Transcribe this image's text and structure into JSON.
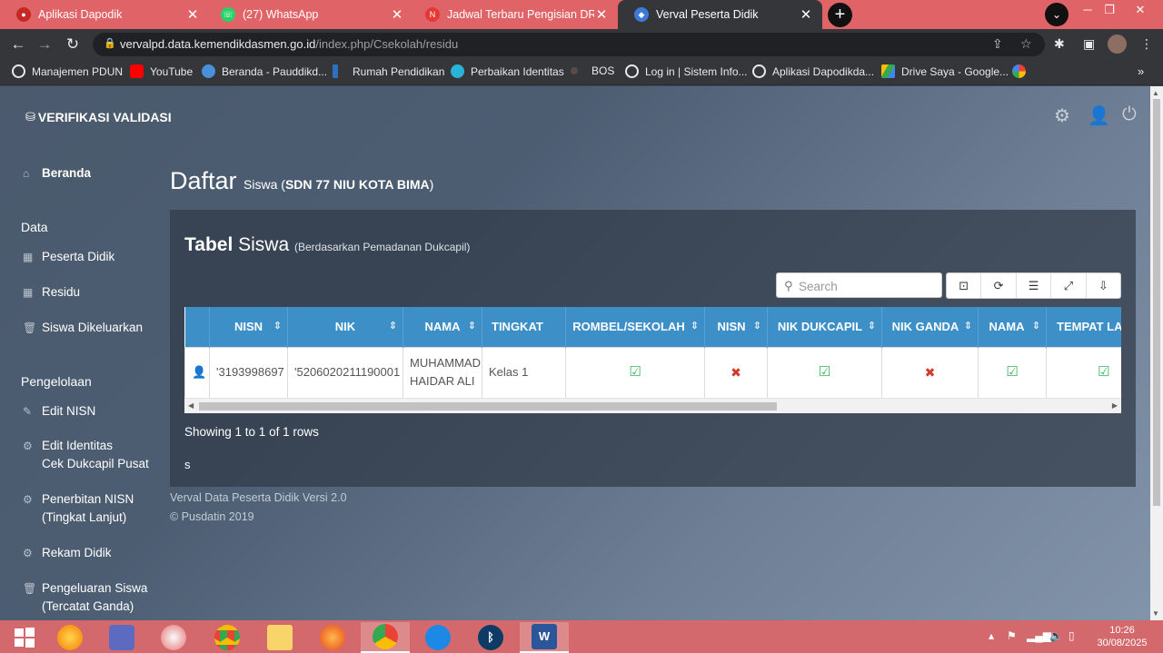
{
  "browser": {
    "tabs": [
      {
        "title": "Aplikasi Dapodik",
        "color": "#c62828"
      },
      {
        "title": "(27) WhatsApp",
        "color": "#25d366"
      },
      {
        "title": "Jadwal Terbaru Pengisian DRH PPPK",
        "color": "#e53935"
      },
      {
        "title": "Verval Peserta Didik",
        "color": "#3d7ad6"
      }
    ],
    "url_domain": "vervalpd.data.kemendikdasmen.go.id",
    "url_path": "/index.php/Csekolah/residu",
    "bookmarks": [
      {
        "label": "Manajemen PDUN",
        "icon": "globe-icon"
      },
      {
        "label": "YouTube",
        "icon": "youtube-icon"
      },
      {
        "label": "Beranda - Pauddikd...",
        "icon": "paud-icon"
      },
      {
        "label": "Rumah Pendidikan",
        "icon": "rumah-icon"
      },
      {
        "label": "Perbaikan Identitas",
        "icon": "perbaikan-icon"
      },
      {
        "label": "BOS",
        "icon": "bos-icon"
      },
      {
        "label": "Log in | Sistem Info...",
        "icon": "globe-icon"
      },
      {
        "label": "Aplikasi Dapodikda...",
        "icon": "globe-icon"
      },
      {
        "label": "Drive Saya - Google...",
        "icon": "drive-icon"
      }
    ]
  },
  "app": {
    "brand": "VERIFIKASI VALIDASI",
    "sidebar": {
      "beranda": "Beranda",
      "data_heading": "Data",
      "data_items": [
        "Peserta Didik",
        "Residu",
        "Siswa Dikeluarkan"
      ],
      "pengelolaan_heading": "Pengelolaan",
      "edit_nisn": "Edit NISN",
      "edit_identitas_1": "Edit Identitas",
      "edit_identitas_2": "Cek Dukcapil Pusat",
      "penerbitan_1": "Penerbitan NISN",
      "penerbitan_2": "(Tingkat Lanjut)",
      "rekam_didik": "Rekam Didik",
      "pengeluaran_1": "Pengeluaran Siswa",
      "pengeluaran_2": "(Tercatat Ganda)"
    },
    "page_title_main": "Daftar",
    "page_title_sub": "Siswa (",
    "page_title_school": "SDN 77 NIU KOTA BIMA",
    "page_title_close": ")",
    "panel": {
      "title_bold": "Tabel",
      "title_rest": " Siswa ",
      "title_small": "(Berdasarkan Pemadanan Dukcapil)"
    },
    "search_placeholder": "Search",
    "table": {
      "headers": [
        "",
        "NISN",
        "NIK",
        "NAMA",
        "TINGKAT",
        "ROMBEL/SEKOLAH",
        "NISN",
        "NIK DUKCAPIL",
        "NIK GANDA",
        "NAMA",
        "TEMPAT LAHIR"
      ],
      "row": {
        "nisn": "'3193998697",
        "nik": "'5206020211190001",
        "nama": "MUHAMMAD HAIDAR ALI",
        "tingkat": "Kelas 1",
        "checks": [
          true,
          false,
          true,
          false,
          true,
          true
        ]
      }
    },
    "showing": "Showing 1 to 1 of 1 rows",
    "stray_text": "s",
    "footer_line1": "Verval Data Peserta Didik Versi 2.0",
    "footer_line2": "© Pusdatin 2019"
  },
  "taskbar": {
    "time": "10:26",
    "date": "30/08/2025"
  }
}
